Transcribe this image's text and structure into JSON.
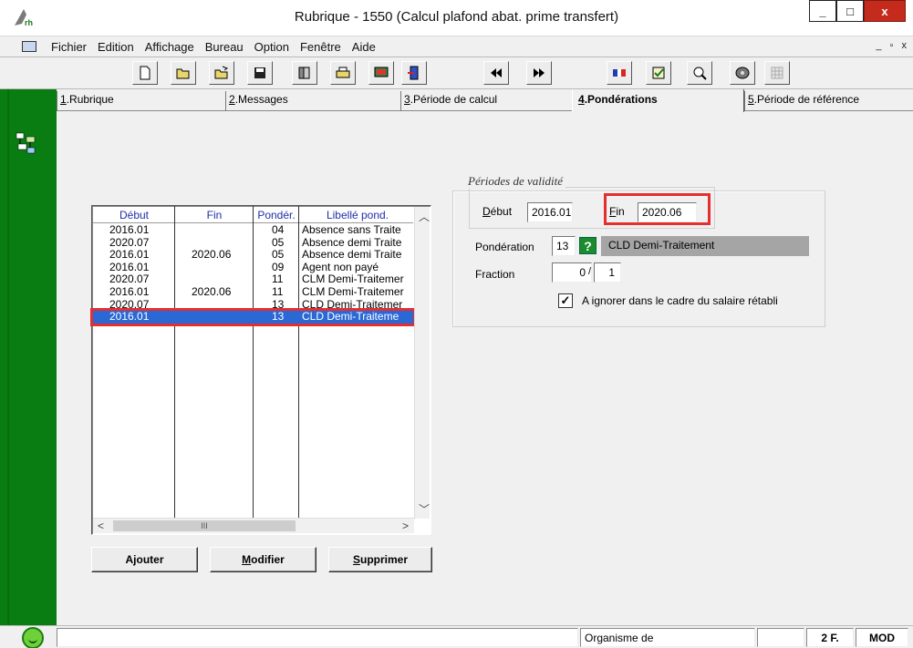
{
  "window": {
    "title": "Rubrique - 1550 (Calcul plafond abat. prime transfert)",
    "minimize": "_",
    "maximize": "□",
    "close": "x"
  },
  "menu": {
    "items": [
      "Fichier",
      "Edition",
      "Affichage",
      "Bureau",
      "Option",
      "Fenêtre",
      "Aide"
    ],
    "mdi_controls": "_ ▫ x"
  },
  "toolbar": {
    "buttons": [
      "new-document-icon",
      "open-folder-icon",
      "open-folder-arrow-icon",
      "save-floppy-icon",
      "binder-icon",
      "print-folder-icon",
      "screen-icon",
      "exit-door-icon",
      "rewind-icon",
      "fast-forward-icon",
      "flag-icon",
      "checklist-icon",
      "magnifier-icon",
      "disk-icon",
      "grid-disabled-icon"
    ]
  },
  "tabs": [
    {
      "key": "1",
      "label": ".Rubrique",
      "active": false
    },
    {
      "key": "2",
      "label": ".Messages",
      "active": false
    },
    {
      "key": "3",
      "label": ".Période de calcul",
      "active": false
    },
    {
      "key": "4",
      "label": ".Pondérations",
      "active": true
    },
    {
      "key": "5",
      "label": ".Période de référence",
      "active": false
    }
  ],
  "list": {
    "headers": {
      "debut": "Début",
      "fin": "Fin",
      "ponder": "Pondér.",
      "libelle": "Libellé pond."
    },
    "rows": [
      {
        "debut": "2016.01",
        "fin": "",
        "ponder": "04",
        "libelle": "Absence sans Traite",
        "selected": false
      },
      {
        "debut": "2020.07",
        "fin": "",
        "ponder": "05",
        "libelle": "Absence demi Traite",
        "selected": false
      },
      {
        "debut": "2016.01",
        "fin": "2020.06",
        "ponder": "05",
        "libelle": "Absence demi Traite",
        "selected": false
      },
      {
        "debut": "2016.01",
        "fin": "",
        "ponder": "09",
        "libelle": "Agent non payé",
        "selected": false
      },
      {
        "debut": "2020.07",
        "fin": "",
        "ponder": "11",
        "libelle": "CLM Demi-Traitemer",
        "selected": false
      },
      {
        "debut": "2016.01",
        "fin": "2020.06",
        "ponder": "11",
        "libelle": "CLM Demi-Traitemer",
        "selected": false
      },
      {
        "debut": "2020.07",
        "fin": "",
        "ponder": "13",
        "libelle": "CLD Demi-Traitemer",
        "selected": false
      },
      {
        "debut": "2016.01",
        "fin": "",
        "ponder": "13",
        "libelle": "CLD Demi-Traiteme",
        "selected": true
      }
    ],
    "hscroll_thumb": "III"
  },
  "buttons": {
    "ajouter": "Ajouter",
    "modifier_key": "M",
    "modifier_rest": "odifier",
    "supprimer_key": "S",
    "supprimer_rest": "upprimer"
  },
  "validity": {
    "title": "Périodes de validité",
    "debut_key": "D",
    "debut_rest": "ébut",
    "debut_value": "2016.01",
    "fin_key": "F",
    "fin_rest": "in",
    "fin_value": "2020.06"
  },
  "ponderation": {
    "label": "Pondération",
    "code": "13",
    "help": "?",
    "libelle": "CLD Demi-Traitement"
  },
  "fraction": {
    "label": "Fraction",
    "numerator": "0",
    "separator": "/",
    "denominator": "1"
  },
  "ignore_checkbox": {
    "checked": true,
    "mark": "✓",
    "label": "A ignorer dans le cadre du salaire rétabli"
  },
  "status": {
    "main": "",
    "organisme": "Organisme de",
    "blank": "",
    "currency": "2 F.",
    "mode": "MOD"
  },
  "colors": {
    "side_green": "#0a7d12",
    "selection_blue": "#2a68d6",
    "highlight_red": "#e52e2e",
    "header_blue": "#1e2fa8"
  }
}
